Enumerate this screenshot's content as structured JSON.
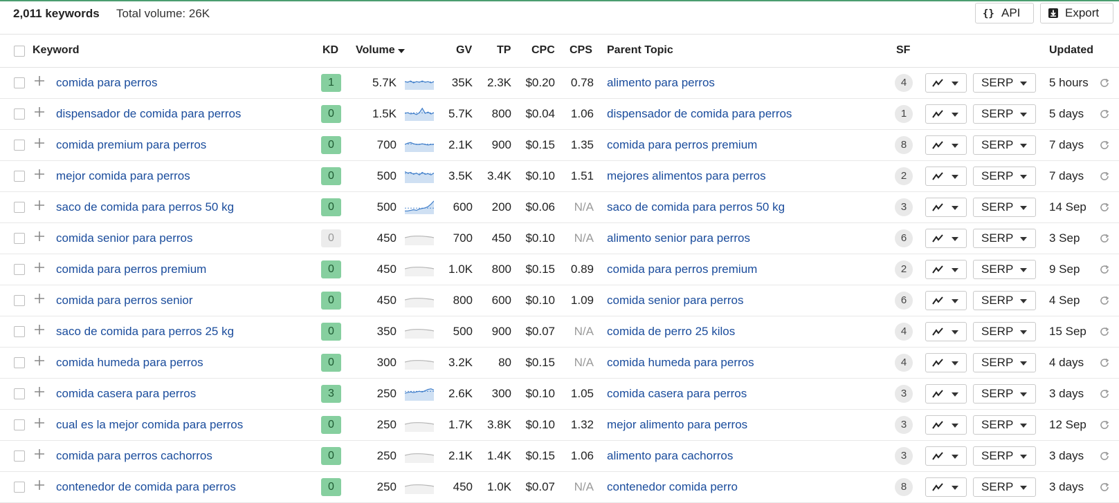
{
  "summary": {
    "keyword_count": "2,011 keywords",
    "total_volume": "Total volume: 26K"
  },
  "toolbar": {
    "api_label": "API",
    "export_label": "Export"
  },
  "columns": {
    "keyword": "Keyword",
    "kd": "KD",
    "volume": "Volume",
    "gv": "GV",
    "tp": "TP",
    "cpc": "CPC",
    "cps": "CPS",
    "parent_topic": "Parent Topic",
    "sf": "SF",
    "updated": "Updated"
  },
  "serp_label": "SERP",
  "colors": {
    "link": "#1a4c9c",
    "kd_green": "#86cf9f",
    "top_accent": "#4a9d6f"
  },
  "rows": [
    {
      "keyword": "comida para perros",
      "kd": "1",
      "volume": "5.7K",
      "gv": "35K",
      "tp": "2.3K",
      "cpc": "$0.20",
      "cps": "0.78",
      "parent": "alimento para perros",
      "sf": "4",
      "updated": "5 hours",
      "spark": [
        0.55,
        0.5,
        0.6,
        0.45,
        0.55,
        0.5,
        0.6,
        0.5,
        0.55,
        0.45,
        0.55
      ]
    },
    {
      "keyword": "dispensador de comida para perros",
      "kd": "0",
      "volume": "1.5K",
      "gv": "5.7K",
      "tp": "800",
      "cpc": "$0.04",
      "cps": "1.06",
      "parent": "dispensador de comida para perros",
      "sf": "1",
      "updated": "5 days",
      "spark": [
        0.5,
        0.55,
        0.45,
        0.5,
        0.4,
        0.55,
        0.9,
        0.5,
        0.6,
        0.45,
        0.55
      ]
    },
    {
      "keyword": "comida premium para perros",
      "kd": "0",
      "volume": "700",
      "gv": "2.1K",
      "tp": "900",
      "cpc": "$0.15",
      "cps": "1.35",
      "parent": "comida para perros premium",
      "sf": "8",
      "updated": "7 days",
      "spark": [
        0.5,
        0.6,
        0.65,
        0.55,
        0.5,
        0.5,
        0.55,
        0.5,
        0.45,
        0.5,
        0.5
      ]
    },
    {
      "keyword": "mejor comida para perros",
      "kd": "0",
      "volume": "500",
      "gv": "3.5K",
      "tp": "3.4K",
      "cpc": "$0.10",
      "cps": "1.51",
      "parent": "mejores alimentos para perros",
      "sf": "2",
      "updated": "7 days",
      "spark": [
        0.8,
        0.7,
        0.75,
        0.6,
        0.7,
        0.55,
        0.75,
        0.6,
        0.65,
        0.55,
        0.7
      ]
    },
    {
      "keyword": "saco de comida para perros 50 kg",
      "kd": "0",
      "volume": "500",
      "gv": "600",
      "tp": "200",
      "cpc": "$0.06",
      "cps": "N/A",
      "parent": "saco de comida para perros 50 kg",
      "sf": "3",
      "updated": "14 Sep",
      "spark": [
        0.15,
        0.15,
        0.2,
        0.25,
        0.2,
        0.3,
        0.35,
        0.4,
        0.5,
        0.7,
        0.95
      ]
    },
    {
      "keyword": "comida senior para perros",
      "kd": "0",
      "volume": "450",
      "gv": "700",
      "tp": "450",
      "cpc": "$0.10",
      "cps": "N/A",
      "parent": "alimento senior para perros",
      "sf": "6",
      "updated": "3 Sep",
      "spark": [
        0.5,
        0.55,
        0.6,
        0.62,
        0.63,
        0.63,
        0.62,
        0.6,
        0.58,
        0.55,
        0.5
      ]
    },
    {
      "keyword": "comida para perros premium",
      "kd": "0",
      "volume": "450",
      "gv": "1.0K",
      "tp": "800",
      "cpc": "$0.15",
      "cps": "0.89",
      "parent": "comida para perros premium",
      "sf": "2",
      "updated": "9 Sep",
      "spark": [
        0.5,
        0.55,
        0.6,
        0.62,
        0.63,
        0.63,
        0.62,
        0.6,
        0.58,
        0.55,
        0.5
      ]
    },
    {
      "keyword": "comida para perros senior",
      "kd": "0",
      "volume": "450",
      "gv": "800",
      "tp": "600",
      "cpc": "$0.10",
      "cps": "1.09",
      "parent": "comida senior para perros",
      "sf": "6",
      "updated": "4 Sep",
      "spark": [
        0.5,
        0.55,
        0.6,
        0.62,
        0.63,
        0.63,
        0.62,
        0.6,
        0.58,
        0.55,
        0.5
      ]
    },
    {
      "keyword": "saco de comida para perros 25 kg",
      "kd": "0",
      "volume": "350",
      "gv": "500",
      "tp": "900",
      "cpc": "$0.07",
      "cps": "N/A",
      "parent": "comida de perro 25 kilos",
      "sf": "4",
      "updated": "15 Sep",
      "spark": [
        0.5,
        0.55,
        0.6,
        0.62,
        0.63,
        0.63,
        0.62,
        0.6,
        0.58,
        0.55,
        0.5
      ]
    },
    {
      "keyword": "comida humeda para perros",
      "kd": "0",
      "volume": "300",
      "gv": "3.2K",
      "tp": "80",
      "cpc": "$0.15",
      "cps": "N/A",
      "parent": "comida humeda para perros",
      "sf": "4",
      "updated": "4 days",
      "spark": [
        0.5,
        0.55,
        0.6,
        0.62,
        0.63,
        0.63,
        0.62,
        0.6,
        0.58,
        0.55,
        0.5
      ]
    },
    {
      "keyword": "comida casera para perros",
      "kd": "3",
      "volume": "250",
      "gv": "2.6K",
      "tp": "300",
      "cpc": "$0.10",
      "cps": "1.05",
      "parent": "comida casera para perros",
      "sf": "3",
      "updated": "3 days",
      "spark": [
        0.5,
        0.55,
        0.6,
        0.55,
        0.6,
        0.65,
        0.6,
        0.7,
        0.8,
        0.85,
        0.75
      ]
    },
    {
      "keyword": "cual es la mejor comida para perros",
      "kd": "0",
      "volume": "250",
      "gv": "1.7K",
      "tp": "3.8K",
      "cpc": "$0.10",
      "cps": "1.32",
      "parent": "mejor alimento para perros",
      "sf": "3",
      "updated": "12 Sep",
      "spark": [
        0.5,
        0.55,
        0.6,
        0.62,
        0.63,
        0.63,
        0.62,
        0.6,
        0.58,
        0.55,
        0.5
      ]
    },
    {
      "keyword": "comida para perros cachorros",
      "kd": "0",
      "volume": "250",
      "gv": "2.1K",
      "tp": "1.4K",
      "cpc": "$0.15",
      "cps": "1.06",
      "parent": "alimento para cachorros",
      "sf": "3",
      "updated": "3 days",
      "spark": [
        0.5,
        0.55,
        0.6,
        0.62,
        0.63,
        0.63,
        0.62,
        0.6,
        0.58,
        0.55,
        0.5
      ]
    },
    {
      "keyword": "contenedor de comida para perros",
      "kd": "0",
      "volume": "250",
      "gv": "450",
      "tp": "1.0K",
      "cpc": "$0.07",
      "cps": "N/A",
      "parent": "contenedor comida perro",
      "sf": "8",
      "updated": "3 days",
      "spark": [
        0.5,
        0.55,
        0.6,
        0.62,
        0.63,
        0.63,
        0.62,
        0.6,
        0.58,
        0.55,
        0.5
      ]
    }
  ]
}
